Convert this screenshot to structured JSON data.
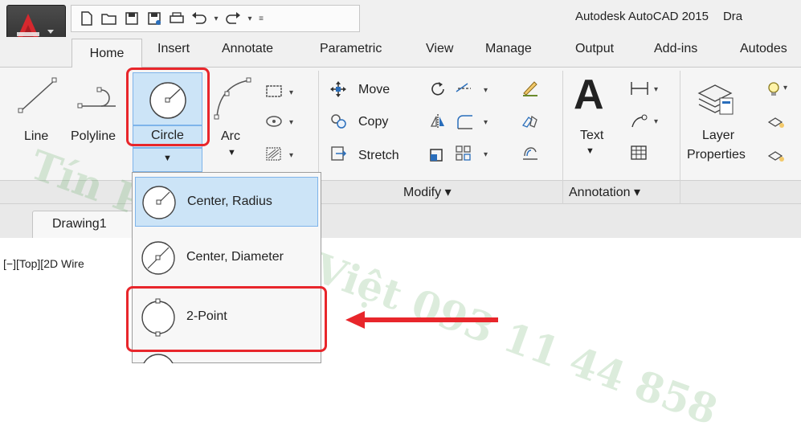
{
  "window": {
    "title": "Autodesk AutoCAD 2015",
    "title_cut": "Dra"
  },
  "tabs": [
    "Home",
    "Insert",
    "Annotate",
    "Parametric",
    "View",
    "Manage",
    "Output",
    "Add-ins",
    "Autodes"
  ],
  "draw": {
    "line": "Line",
    "polyline": "Polyline",
    "circle": "Circle",
    "arc": "Arc"
  },
  "modify": {
    "move": "Move",
    "copy": "Copy",
    "stretch": "Stretch",
    "panel": "Modify ▾"
  },
  "annotation": {
    "text": "Text",
    "panel": "Annotation ▾"
  },
  "layers": {
    "properties_line1": "Layer",
    "properties_line2": "Properties"
  },
  "doc": {
    "tab": "Drawing1",
    "viewport": "[−][Top][2D Wire"
  },
  "circle_menu": {
    "items": [
      "Center, Radius",
      "Center, Diameter",
      "2-Point"
    ]
  },
  "watermark": "Tín Phát Sao Việt 093 11 44 858",
  "colors": {
    "accent_red": "#e8262b",
    "highlight": "#cce4f7",
    "logo_red": "#d6282e"
  }
}
